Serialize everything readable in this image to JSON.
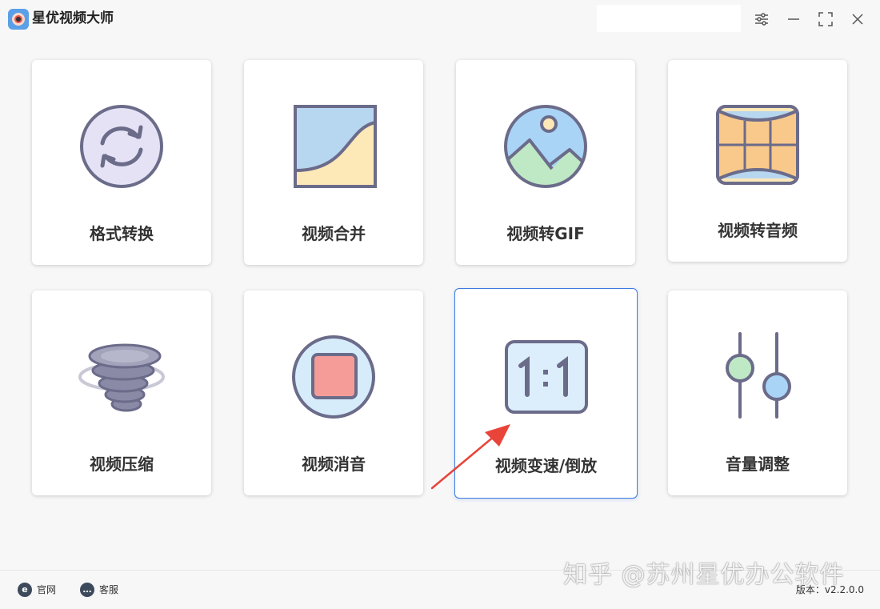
{
  "app": {
    "title": "星优视频大师"
  },
  "titlebar": {
    "search_value": ""
  },
  "window_controls": [
    "settings-icon",
    "minimize-icon",
    "maximize-icon",
    "close-icon"
  ],
  "tools": [
    {
      "label": "格式转换",
      "icon": "convert-icon"
    },
    {
      "label": "视频合并",
      "icon": "merge-icon"
    },
    {
      "label": "视频转GIF",
      "icon": "image-icon"
    },
    {
      "label": "视频转音频",
      "icon": "audio-film-icon"
    },
    {
      "label": "视频压缩",
      "icon": "tornado-icon"
    },
    {
      "label": "视频消音",
      "icon": "stop-icon"
    },
    {
      "label": "视频变速/倒放",
      "icon": "ratio-icon",
      "selected": true
    },
    {
      "label": "音量调整",
      "icon": "sliders-icon"
    }
  ],
  "footer": {
    "website_label": "官网",
    "support_label": "客服",
    "version": "版本：v2.2.0.0"
  },
  "watermark": "知乎 @苏州星优办公软件",
  "colors": {
    "background": "#f7f7f8",
    "card": "#ffffff",
    "selected_border": "#3d7be0",
    "icon_stroke": "#6b6b8a",
    "arrow": "#e8443a"
  }
}
